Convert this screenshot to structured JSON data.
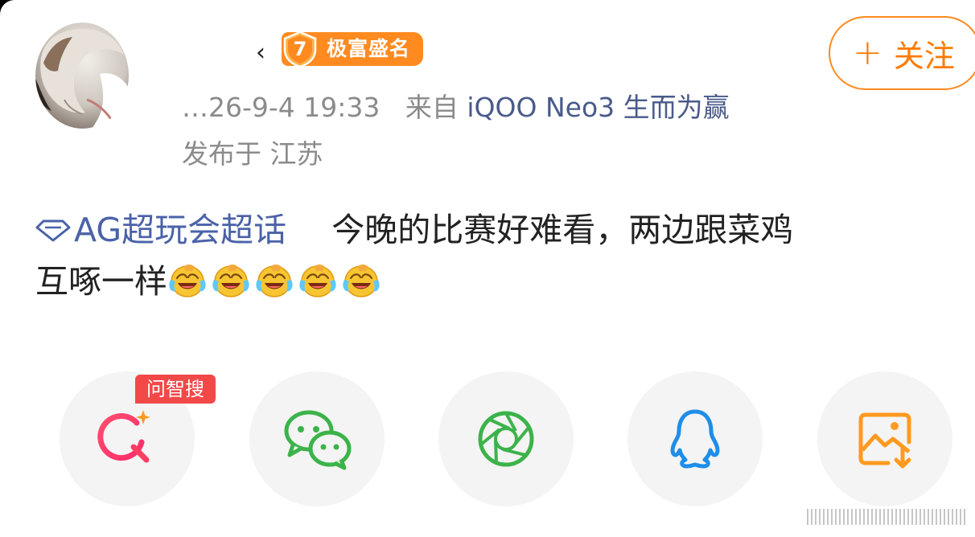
{
  "header": {
    "username_visible": "‹",
    "rank_level": "7",
    "rank_label": "极富盛名",
    "follow_label": "关注",
    "follow_plus": "+",
    "timestamp": "…26-9-4 19:33",
    "source_prefix": "来自",
    "source_device": "iQOO Neo3 生而为赢",
    "location": "发布于 江苏"
  },
  "post": {
    "topic": "AG超玩会超话",
    "line1_text": "今晚的比赛好难看，两边跟菜鸡",
    "line2_text": "互啄一样",
    "emoji_name": "laugh-cry-emoji",
    "emoji_count": 5
  },
  "share": {
    "search_tag": "问智搜",
    "items": [
      "search-ai",
      "wechat",
      "moments",
      "qq",
      "save-image"
    ]
  },
  "colors": {
    "accent_orange": "#ff8a1f",
    "topic_blue": "#4a62a8",
    "meta_gray": "#8b8b8b",
    "wechat_green": "#3cb34a",
    "qq_blue": "#1e8ee8",
    "search_red": "#f24848"
  }
}
